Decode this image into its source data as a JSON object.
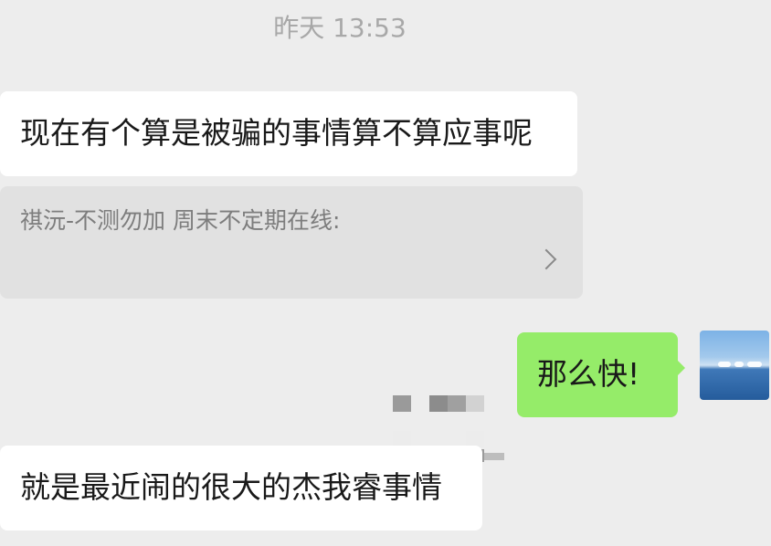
{
  "timestamp": "昨天 13:53",
  "messages": {
    "incoming_1": "现在有个算是被骗的事情算不算应事呢",
    "quote": {
      "text": "祺沅-不测勿加 周末不定期在线:",
      "more_icon": "chevron-right-icon"
    },
    "outgoing_1": "那么快!",
    "incoming_2": "就是最近闹的很大的杰我睿事情"
  },
  "colors": {
    "background": "#ededed",
    "incoming_bubble": "#ffffff",
    "outgoing_bubble": "#95ec69",
    "quote_bubble": "#e1e1e1",
    "timestamp_text": "#a8a8a8"
  }
}
